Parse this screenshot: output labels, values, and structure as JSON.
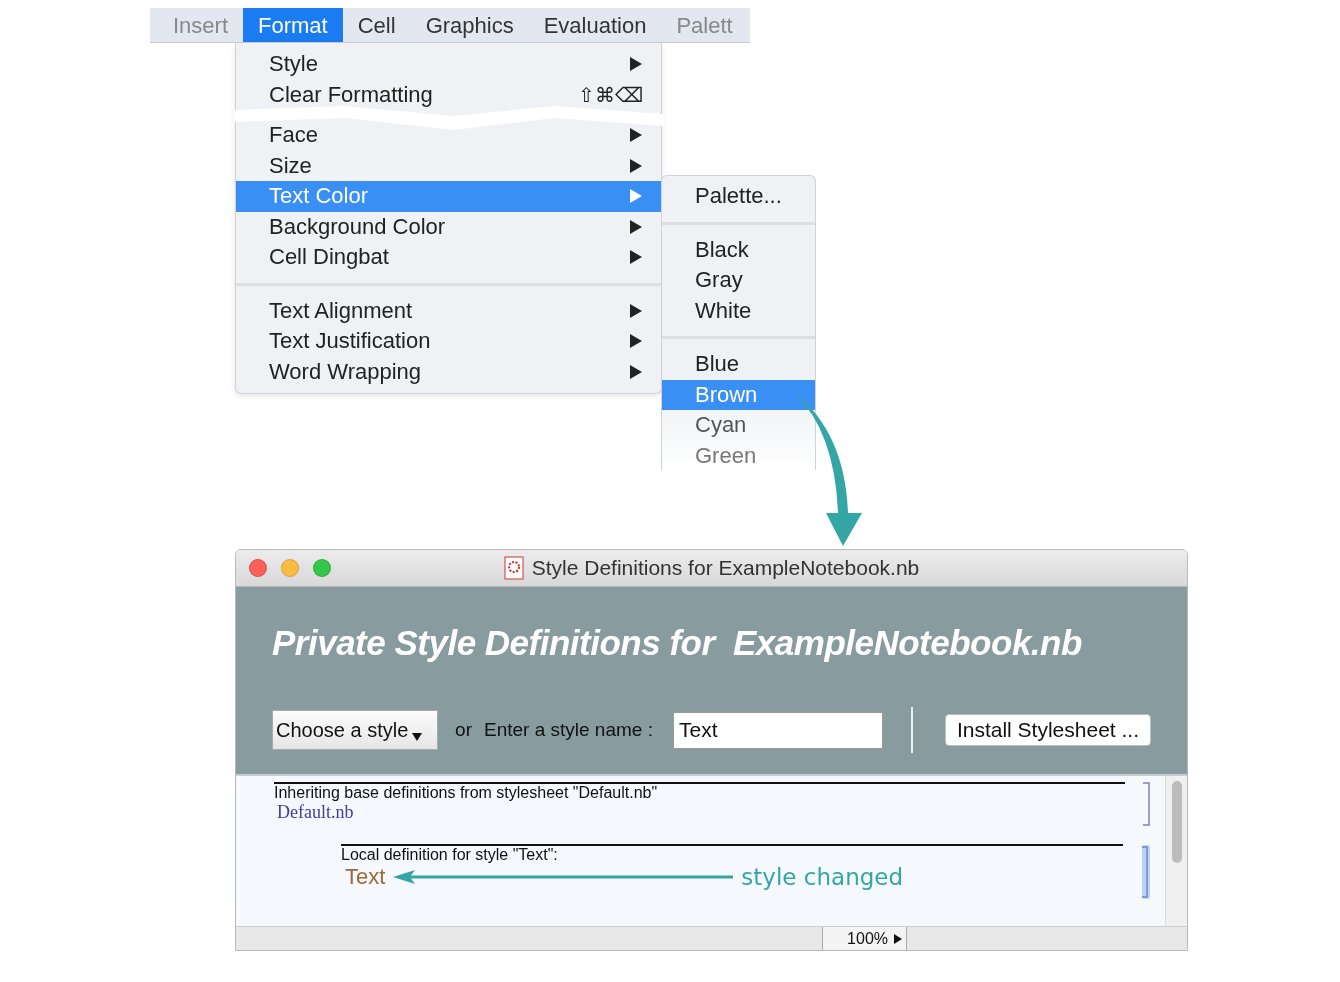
{
  "menu_bar": [
    {
      "label": "Insert",
      "selected": false
    },
    {
      "label": "Format",
      "selected": true
    },
    {
      "label": "Cell",
      "selected": false
    },
    {
      "label": "Graphics",
      "selected": false
    },
    {
      "label": "Evaluation",
      "selected": false
    },
    {
      "label": "Palett",
      "selected": false
    }
  ],
  "format_menu": [
    {
      "kind": "item",
      "label": "Style",
      "submenu": true,
      "selected": false
    },
    {
      "kind": "item",
      "label": "Clear Formatting",
      "shortcut": "⇧⌘⌫",
      "submenu": false,
      "selected": false
    },
    {
      "kind": "tear"
    },
    {
      "kind": "item",
      "label": "Face",
      "submenu": true,
      "selected": false
    },
    {
      "kind": "item",
      "label": "Size",
      "submenu": true,
      "selected": false
    },
    {
      "kind": "item",
      "label": "Text Color",
      "submenu": true,
      "selected": true
    },
    {
      "kind": "item",
      "label": "Background Color",
      "submenu": true,
      "selected": false
    },
    {
      "kind": "item",
      "label": "Cell Dingbat",
      "submenu": true,
      "selected": false
    },
    {
      "kind": "separator"
    },
    {
      "kind": "item",
      "label": "Text Alignment",
      "submenu": true,
      "selected": false
    },
    {
      "kind": "item",
      "label": "Text Justification",
      "submenu": true,
      "selected": false
    },
    {
      "kind": "item",
      "label": "Word Wrapping",
      "submenu": true,
      "selected": false
    }
  ],
  "color_submenu": [
    {
      "kind": "item",
      "label": "Palette...",
      "selected": false
    },
    {
      "kind": "separator"
    },
    {
      "kind": "item",
      "label": "Black",
      "selected": false
    },
    {
      "kind": "item",
      "label": "Gray",
      "selected": false
    },
    {
      "kind": "item",
      "label": "White",
      "selected": false
    },
    {
      "kind": "separator"
    },
    {
      "kind": "item",
      "label": "Blue",
      "selected": false
    },
    {
      "kind": "item",
      "label": "Brown",
      "selected": true
    },
    {
      "kind": "item",
      "label": "Cyan",
      "selected": false
    },
    {
      "kind": "item",
      "label": "Green",
      "selected": false
    }
  ],
  "window": {
    "title": "Style Definitions for ExampleNotebook.nb",
    "heading": "Private Style Definitions for  ExampleNotebook.nb",
    "style_popup": "Choose a style",
    "or_label": "or",
    "name_label": "Enter a style name :",
    "name_value": "Text",
    "install_button": "Install Stylesheet ...",
    "inherit_note": "Inheriting base definitions from stylesheet \"Default.nb\"",
    "stylesheet_link": "Default.nb",
    "local_note": "Local definition for style \"Text\":",
    "sample_text": "Text",
    "zoom": "100%"
  },
  "annotation": {
    "text": "style changed"
  }
}
